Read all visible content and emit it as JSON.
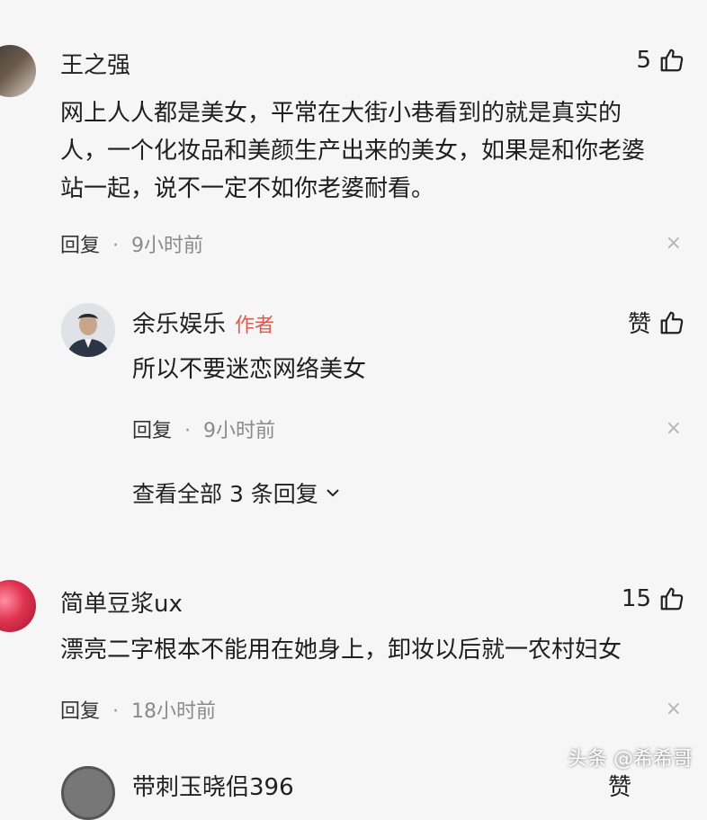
{
  "comments": [
    {
      "user": "王之强",
      "likes": "5",
      "text_lines": [
        "网上人人都是美女，平常在大街小巷看到的就是真实的",
        "人，一个化妆品和美颜生产出来的美女，如果是和你老婆",
        "站一起，说不一定不如你老婆耐看。"
      ],
      "reply_label": "回复",
      "separator": "·",
      "time": "9小时前"
    },
    {
      "user": "余乐娱乐",
      "author_tag": "作者",
      "likes": "赞",
      "text_lines": [
        "所以不要迷恋网络美女"
      ],
      "reply_label": "回复",
      "separator": "·",
      "time": "9小时前",
      "view_all": "查看全部 3 条回复"
    },
    {
      "user": "简单豆浆ux",
      "likes": "15",
      "text_lines": [
        "漂亮二字根本不能用在她身上，卸妆以后就一农村妇女"
      ],
      "reply_label": "回复",
      "separator": "·",
      "time": "18小时前"
    },
    {
      "user": "带刺玉晓侣396",
      "likes": "赞"
    }
  ],
  "close_glyph": "×",
  "watermark": "头条 @希希哥",
  "colors": {
    "author_tag": "#e05a4e",
    "background": "#f6f6f6",
    "time": "#8a8a8a"
  }
}
